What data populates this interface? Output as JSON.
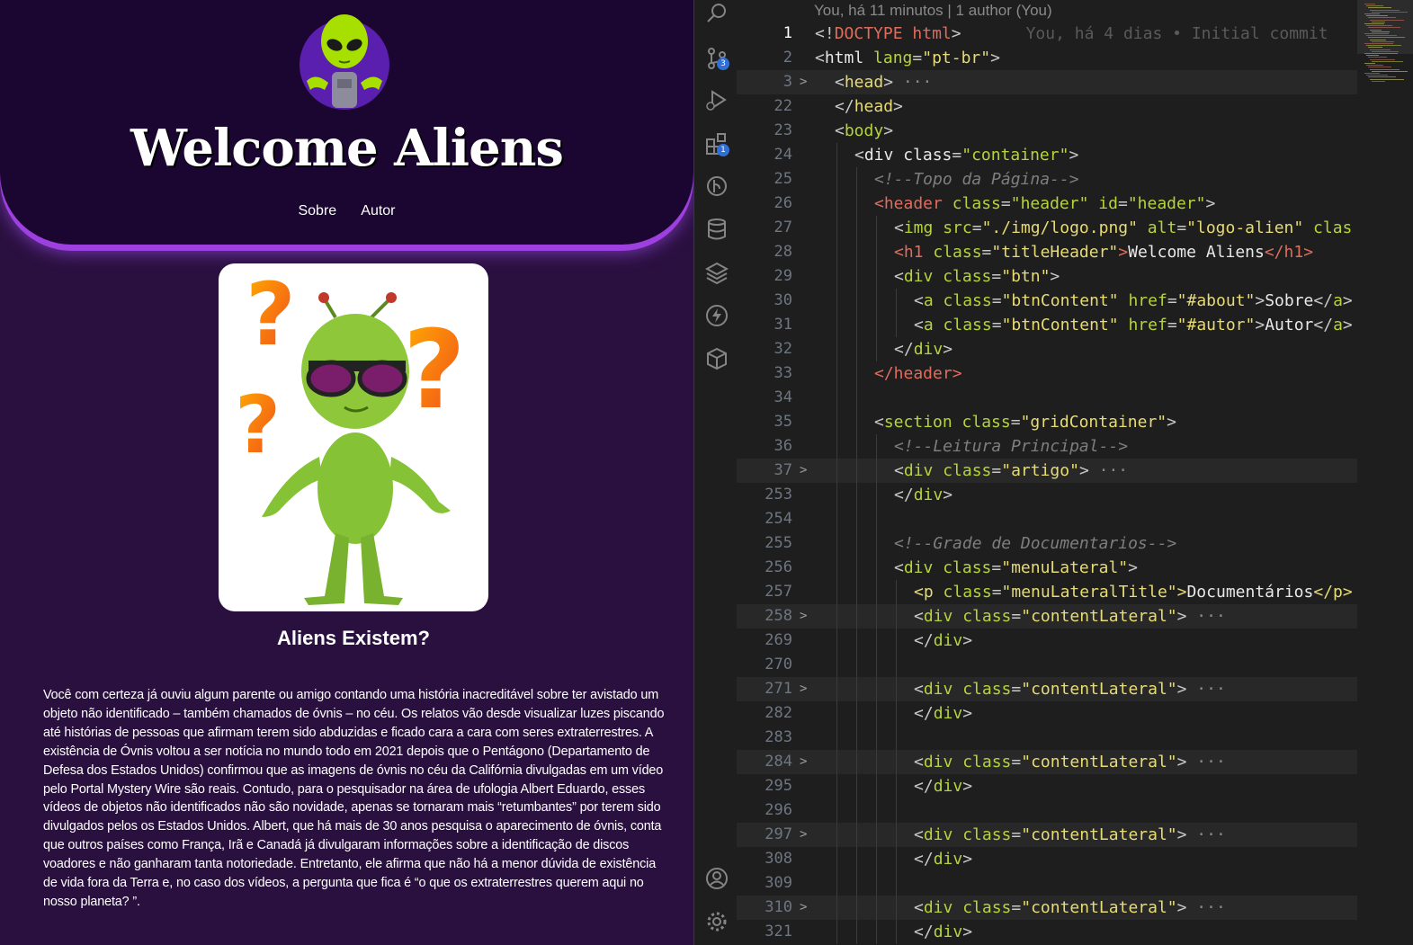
{
  "preview": {
    "site_title": "Welcome Aliens",
    "nav": [
      {
        "label": "Sobre"
      },
      {
        "label": "Autor"
      }
    ],
    "article_title": "Aliens Existem?",
    "article_text": "Você com certeza já ouviu algum parente ou amigo contando uma história inacreditável sobre ter avistado um objeto não identificado – também chamados de óvnis – no céu. Os relatos vão desde visualizar luzes piscando até histórias de pessoas que afirmam terem sido abduzidas e ficado cara a cara com seres extraterrestres. A existência de Óvnis voltou a ser notícia no mundo todo em 2021 depois que o Pentágono (Departamento de Defesa dos Estados Unidos) confirmou que as imagens de óvnis no céu da Califórnia divulgadas em um vídeo pelo Portal Mystery Wire são reais. Contudo, para o pesquisador na área de ufologia Albert Eduardo, esses vídeos de objetos não identificados não são novidade, apenas se tornaram mais “retumbantes” por terem sido divulgados pelos os Estados Unidos. Albert, que há mais de 30 anos pesquisa o aparecimento de óvnis, conta que outros países como França, Irã e Canadá já divulgaram informações sobre a identificação de discos voadores e não ganharam tanta notoriedade. Entretanto, ele afirma que não há a menor dúvida de existência de vida fora da Terra e, no caso dos vídeos, a pergunta que fica é “o que os extraterrestres querem aqui no nosso planeta? ”."
  },
  "editor": {
    "blame_header": "You, há 11 minutos | 1 author (You)",
    "activity_bar": {
      "items": [
        "search-icon",
        "source-control-icon",
        "run-debug-icon",
        "extensions-icon",
        "git-graph-icon",
        "database-icon",
        "layers-icon",
        "lightning-icon",
        "package-icon",
        "account-icon",
        "settings-gear-icon"
      ],
      "source_control_badge": "3",
      "extensions_badge": "1"
    },
    "lines": [
      {
        "n": "1",
        "fold": "",
        "indent": 0,
        "tokens": [
          [
            "lt",
            "<!"
          ],
          [
            "doctype",
            "DOCTYPE"
          ],
          [
            "txt",
            " "
          ],
          [
            "tag",
            "html"
          ],
          [
            "lt",
            ">"
          ]
        ],
        "blame": "You, há 4 dias • Initial commit",
        "current": true
      },
      {
        "n": "2",
        "fold": "",
        "indent": 0,
        "tokens": [
          [
            "lt",
            "<"
          ],
          [
            "txt",
            "html "
          ],
          [
            "attr",
            "lang"
          ],
          [
            "lt",
            "="
          ],
          [
            "str",
            "\"pt-br\""
          ],
          [
            "lt",
            ">"
          ]
        ]
      },
      {
        "n": "3",
        "fold": ">",
        "indent": 1,
        "tokens": [
          [
            "lt",
            "<"
          ],
          [
            "str",
            "head"
          ],
          [
            "lt",
            ">"
          ],
          [
            "fold",
            " ···"
          ]
        ],
        "hl": true
      },
      {
        "n": "22",
        "fold": "",
        "indent": 1,
        "tokens": [
          [
            "lt",
            "</"
          ],
          [
            "str",
            "head"
          ],
          [
            "lt",
            ">"
          ]
        ]
      },
      {
        "n": "23",
        "fold": "",
        "indent": 1,
        "tokens": [
          [
            "lt",
            "<"
          ],
          [
            "attr",
            "body"
          ],
          [
            "lt",
            ">"
          ]
        ]
      },
      {
        "n": "24",
        "fold": "",
        "indent": 2,
        "tokens": [
          [
            "lt",
            "<"
          ],
          [
            "txt",
            "div "
          ],
          [
            "txt",
            "class"
          ],
          [
            "lt",
            "="
          ],
          [
            "attr",
            "\"container\""
          ],
          [
            "lt",
            ">"
          ]
        ]
      },
      {
        "n": "25",
        "fold": "",
        "indent": 3,
        "tokens": [
          [
            "com",
            "<!--Topo da Página-->"
          ]
        ]
      },
      {
        "n": "26",
        "fold": "",
        "indent": 3,
        "tokens": [
          [
            "tag",
            "<header "
          ],
          [
            "attr",
            "class"
          ],
          [
            "lt",
            "="
          ],
          [
            "attr",
            "\"header\""
          ],
          [
            "txt",
            " "
          ],
          [
            "attr",
            "id"
          ],
          [
            "lt",
            "="
          ],
          [
            "attr",
            "\"header\""
          ],
          [
            "lt",
            ">"
          ]
        ]
      },
      {
        "n": "27",
        "fold": "",
        "indent": 4,
        "tokens": [
          [
            "lt",
            "<"
          ],
          [
            "attr",
            "img "
          ],
          [
            "attr",
            "src"
          ],
          [
            "lt",
            "="
          ],
          [
            "str",
            "\"./img/logo.png\""
          ],
          [
            "txt",
            " "
          ],
          [
            "attr",
            "alt"
          ],
          [
            "lt",
            "="
          ],
          [
            "str",
            "\"logo-alien\""
          ],
          [
            "txt",
            " "
          ],
          [
            "attr",
            "clas"
          ]
        ]
      },
      {
        "n": "28",
        "fold": "",
        "indent": 4,
        "tokens": [
          [
            "tag",
            "<h1 "
          ],
          [
            "attr",
            "class"
          ],
          [
            "lt",
            "="
          ],
          [
            "str",
            "\"titleHeader\""
          ],
          [
            "tag",
            ">"
          ],
          [
            "txt",
            "Welcome Aliens"
          ],
          [
            "tag",
            "</h1>"
          ]
        ]
      },
      {
        "n": "29",
        "fold": "",
        "indent": 4,
        "tokens": [
          [
            "lt",
            "<"
          ],
          [
            "attr",
            "div "
          ],
          [
            "attr",
            "class"
          ],
          [
            "lt",
            "="
          ],
          [
            "str",
            "\"btn\""
          ],
          [
            "lt",
            ">"
          ]
        ]
      },
      {
        "n": "30",
        "fold": "",
        "indent": 5,
        "tokens": [
          [
            "lt",
            "<"
          ],
          [
            "attr",
            "a "
          ],
          [
            "attr",
            "class"
          ],
          [
            "lt",
            "="
          ],
          [
            "str",
            "\"btnContent\""
          ],
          [
            "txt",
            " "
          ],
          [
            "attr",
            "href"
          ],
          [
            "lt",
            "="
          ],
          [
            "str",
            "\"#about\""
          ],
          [
            "lt",
            ">"
          ],
          [
            "txt",
            "Sobre"
          ],
          [
            "lt",
            "</"
          ],
          [
            "attr",
            "a"
          ],
          [
            "lt",
            ">"
          ]
        ]
      },
      {
        "n": "31",
        "fold": "",
        "indent": 5,
        "tokens": [
          [
            "lt",
            "<"
          ],
          [
            "attr",
            "a "
          ],
          [
            "attr",
            "class"
          ],
          [
            "lt",
            "="
          ],
          [
            "str",
            "\"btnContent\""
          ],
          [
            "txt",
            " "
          ],
          [
            "attr",
            "href"
          ],
          [
            "lt",
            "="
          ],
          [
            "str",
            "\"#autor\""
          ],
          [
            "lt",
            ">"
          ],
          [
            "txt",
            "Autor"
          ],
          [
            "lt",
            "</"
          ],
          [
            "attr",
            "a"
          ],
          [
            "lt",
            ">"
          ]
        ]
      },
      {
        "n": "32",
        "fold": "",
        "indent": 4,
        "tokens": [
          [
            "lt",
            "</"
          ],
          [
            "attr",
            "div"
          ],
          [
            "lt",
            ">"
          ]
        ]
      },
      {
        "n": "33",
        "fold": "",
        "indent": 3,
        "tokens": [
          [
            "tag",
            "</header>"
          ]
        ]
      },
      {
        "n": "34",
        "fold": "",
        "indent": 3,
        "tokens": []
      },
      {
        "n": "35",
        "fold": "",
        "indent": 3,
        "tokens": [
          [
            "lt",
            "<"
          ],
          [
            "attr",
            "section "
          ],
          [
            "attr",
            "class"
          ],
          [
            "lt",
            "="
          ],
          [
            "str",
            "\"gridContainer\""
          ],
          [
            "lt",
            ">"
          ]
        ]
      },
      {
        "n": "36",
        "fold": "",
        "indent": 4,
        "tokens": [
          [
            "com",
            "<!--Leitura Principal-->"
          ]
        ]
      },
      {
        "n": "37",
        "fold": ">",
        "indent": 4,
        "tokens": [
          [
            "lt",
            "<"
          ],
          [
            "attr",
            "div "
          ],
          [
            "attr",
            "class"
          ],
          [
            "lt",
            "="
          ],
          [
            "str",
            "\"artigo\""
          ],
          [
            "lt",
            ">"
          ],
          [
            "fold",
            " ···"
          ]
        ],
        "hl": true
      },
      {
        "n": "253",
        "fold": "",
        "indent": 4,
        "tokens": [
          [
            "lt",
            "</"
          ],
          [
            "attr",
            "div"
          ],
          [
            "lt",
            ">"
          ]
        ]
      },
      {
        "n": "254",
        "fold": "",
        "indent": 4,
        "tokens": []
      },
      {
        "n": "255",
        "fold": "",
        "indent": 4,
        "tokens": [
          [
            "com",
            "<!--Grade de Documentarios-->"
          ]
        ]
      },
      {
        "n": "256",
        "fold": "",
        "indent": 4,
        "tokens": [
          [
            "lt",
            "<"
          ],
          [
            "attr",
            "div "
          ],
          [
            "attr",
            "class"
          ],
          [
            "lt",
            "="
          ],
          [
            "str",
            "\"menuLateral\""
          ],
          [
            "lt",
            ">"
          ]
        ]
      },
      {
        "n": "257",
        "fold": "",
        "indent": 5,
        "tokens": [
          [
            "str",
            "<p "
          ],
          [
            "attr",
            "class"
          ],
          [
            "lt",
            "="
          ],
          [
            "str",
            "\"menuLateralTitle\""
          ],
          [
            "str",
            ">"
          ],
          [
            "txt",
            "Documentários"
          ],
          [
            "str",
            "</p>"
          ]
        ]
      },
      {
        "n": "258",
        "fold": ">",
        "indent": 5,
        "tokens": [
          [
            "lt",
            "<"
          ],
          [
            "attr",
            "div "
          ],
          [
            "attr",
            "class"
          ],
          [
            "lt",
            "="
          ],
          [
            "str",
            "\"contentLateral\""
          ],
          [
            "lt",
            ">"
          ],
          [
            "fold",
            " ···"
          ]
        ],
        "hl": true
      },
      {
        "n": "269",
        "fold": "",
        "indent": 5,
        "tokens": [
          [
            "lt",
            "</"
          ],
          [
            "attr",
            "div"
          ],
          [
            "lt",
            ">"
          ]
        ]
      },
      {
        "n": "270",
        "fold": "",
        "indent": 5,
        "tokens": []
      },
      {
        "n": "271",
        "fold": ">",
        "indent": 5,
        "tokens": [
          [
            "lt",
            "<"
          ],
          [
            "attr",
            "div "
          ],
          [
            "attr",
            "class"
          ],
          [
            "lt",
            "="
          ],
          [
            "str",
            "\"contentLateral\""
          ],
          [
            "lt",
            ">"
          ],
          [
            "fold",
            " ···"
          ]
        ],
        "hl": true
      },
      {
        "n": "282",
        "fold": "",
        "indent": 5,
        "tokens": [
          [
            "lt",
            "</"
          ],
          [
            "attr",
            "div"
          ],
          [
            "lt",
            ">"
          ]
        ]
      },
      {
        "n": "283",
        "fold": "",
        "indent": 5,
        "tokens": []
      },
      {
        "n": "284",
        "fold": ">",
        "indent": 5,
        "tokens": [
          [
            "lt",
            "<"
          ],
          [
            "attr",
            "div "
          ],
          [
            "attr",
            "class"
          ],
          [
            "lt",
            "="
          ],
          [
            "str",
            "\"contentLateral\""
          ],
          [
            "lt",
            ">"
          ],
          [
            "fold",
            " ···"
          ]
        ],
        "hl": true
      },
      {
        "n": "295",
        "fold": "",
        "indent": 5,
        "tokens": [
          [
            "lt",
            "</"
          ],
          [
            "attr",
            "div"
          ],
          [
            "lt",
            ">"
          ]
        ]
      },
      {
        "n": "296",
        "fold": "",
        "indent": 5,
        "tokens": []
      },
      {
        "n": "297",
        "fold": ">",
        "indent": 5,
        "tokens": [
          [
            "lt",
            "<"
          ],
          [
            "attr",
            "div "
          ],
          [
            "attr",
            "class"
          ],
          [
            "lt",
            "="
          ],
          [
            "str",
            "\"contentLateral\""
          ],
          [
            "lt",
            ">"
          ],
          [
            "fold",
            " ···"
          ]
        ],
        "hl": true
      },
      {
        "n": "308",
        "fold": "",
        "indent": 5,
        "tokens": [
          [
            "lt",
            "</"
          ],
          [
            "attr",
            "div"
          ],
          [
            "lt",
            ">"
          ]
        ]
      },
      {
        "n": "309",
        "fold": "",
        "indent": 5,
        "tokens": []
      },
      {
        "n": "310",
        "fold": ">",
        "indent": 5,
        "tokens": [
          [
            "lt",
            "<"
          ],
          [
            "attr",
            "div "
          ],
          [
            "attr",
            "class"
          ],
          [
            "lt",
            "="
          ],
          [
            "str",
            "\"contentLateral\""
          ],
          [
            "lt",
            ">"
          ],
          [
            "fold",
            " ···"
          ]
        ],
        "hl": true
      },
      {
        "n": "321",
        "fold": "",
        "indent": 5,
        "tokens": [
          [
            "lt",
            "</"
          ],
          [
            "attr",
            "div"
          ],
          [
            "lt",
            ">"
          ]
        ]
      }
    ]
  }
}
